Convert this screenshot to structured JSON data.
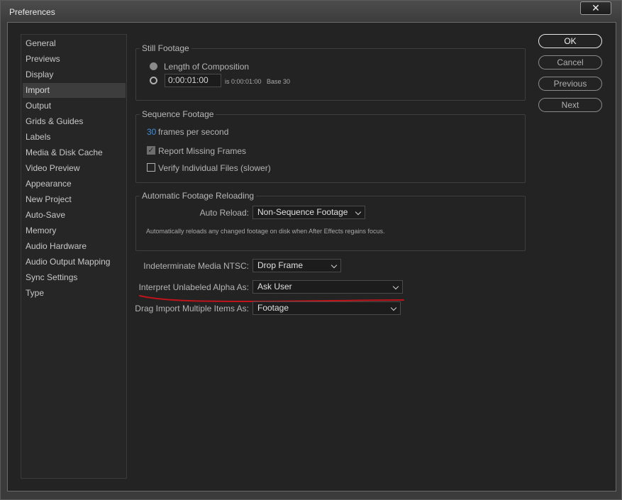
{
  "window": {
    "title": "Preferences",
    "close_icon": "✕"
  },
  "sidebar": {
    "items": [
      {
        "label": "General"
      },
      {
        "label": "Previews"
      },
      {
        "label": "Display"
      },
      {
        "label": "Import",
        "selected": true
      },
      {
        "label": "Output"
      },
      {
        "label": "Grids & Guides"
      },
      {
        "label": "Labels"
      },
      {
        "label": "Media & Disk Cache"
      },
      {
        "label": "Video Preview"
      },
      {
        "label": "Appearance"
      },
      {
        "label": "New Project"
      },
      {
        "label": "Auto-Save"
      },
      {
        "label": "Memory"
      },
      {
        "label": "Audio Hardware"
      },
      {
        "label": "Audio Output Mapping"
      },
      {
        "label": "Sync Settings"
      },
      {
        "label": "Type"
      }
    ]
  },
  "still_footage": {
    "title": "Still Footage",
    "option_length": "Length of Composition",
    "duration_value": "0:00:01:00",
    "duration_info": "is 0:00:01:00",
    "base_info": "Base 30"
  },
  "sequence_footage": {
    "title": "Sequence Footage",
    "fps_value": "30",
    "fps_label": "frames per second",
    "report_missing": "Report Missing Frames",
    "verify_files": "Verify Individual Files (slower)"
  },
  "auto_reload": {
    "title": "Automatic Footage Reloading",
    "label": "Auto Reload:",
    "value": "Non-Sequence Footage",
    "description": "Automatically reloads any changed footage on disk when After Effects regains focus."
  },
  "ntsc": {
    "label": "Indeterminate Media NTSC:",
    "value": "Drop Frame"
  },
  "alpha": {
    "label": "Interpret Unlabeled Alpha As:",
    "value": "Ask User"
  },
  "drag_import": {
    "label": "Drag Import Multiple Items As:",
    "value": "Footage"
  },
  "buttons": {
    "ok": "OK",
    "cancel": "Cancel",
    "previous": "Previous",
    "next": "Next"
  },
  "colors": {
    "annotation_underline": "#c0141a",
    "accent_blue": "#3d8edf"
  }
}
